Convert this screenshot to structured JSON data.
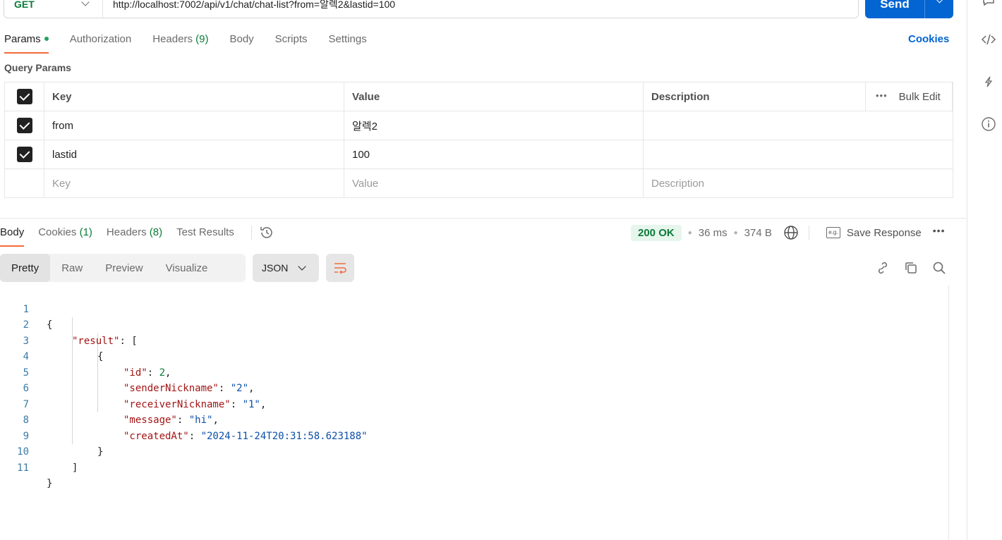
{
  "request": {
    "method": "GET",
    "url": "http://localhost:7002/api/v1/chat/chat-list?from=알렉2&lastid=100",
    "send_label": "Send"
  },
  "tabs": {
    "params": "Params",
    "authorization": "Authorization",
    "headers": "Headers",
    "headers_count": "(9)",
    "body": "Body",
    "scripts": "Scripts",
    "settings": "Settings",
    "cookies": "Cookies"
  },
  "query_params": {
    "title": "Query Params",
    "headers": {
      "key": "Key",
      "value": "Value",
      "description": "Description",
      "bulk_edit": "Bulk Edit"
    },
    "rows": [
      {
        "key": "from",
        "value": "알렉2",
        "description": ""
      },
      {
        "key": "lastid",
        "value": "100",
        "description": ""
      }
    ],
    "placeholders": {
      "key": "Key",
      "value": "Value",
      "description": "Description"
    }
  },
  "response": {
    "tabs": {
      "body": "Body",
      "cookies": "Cookies",
      "cookies_count": "(1)",
      "headers": "Headers",
      "headers_count": "(8)",
      "test_results": "Test Results"
    },
    "status": "200 OK",
    "time": "36 ms",
    "size": "374 B",
    "save_response": "Save Response",
    "views": [
      "Pretty",
      "Raw",
      "Preview",
      "Visualize"
    ],
    "active_view": "Pretty",
    "format": "JSON",
    "body_lines": {
      "l1": "{",
      "l2_key": "\"result\"",
      "l2_rest": ": [",
      "l3": "{",
      "id_key": "\"id\"",
      "id_val": "2",
      "sender_key": "\"senderNickname\"",
      "sender_val": "\"2\"",
      "receiver_key": "\"receiverNickname\"",
      "receiver_val": "\"1\"",
      "message_key": "\"message\"",
      "message_val": "\"hi\"",
      "created_key": "\"createdAt\"",
      "created_val": "\"2024-11-24T20:31:58.623188\"",
      "l9": "}",
      "l10": "]",
      "l11": "}"
    },
    "line_numbers": [
      "1",
      "2",
      "3",
      "4",
      "5",
      "6",
      "7",
      "8",
      "9",
      "10",
      "11"
    ]
  },
  "colors": {
    "accent_orange": "#f26b3a",
    "primary_blue": "#0265d2",
    "success_green": "#0a7b3a"
  }
}
